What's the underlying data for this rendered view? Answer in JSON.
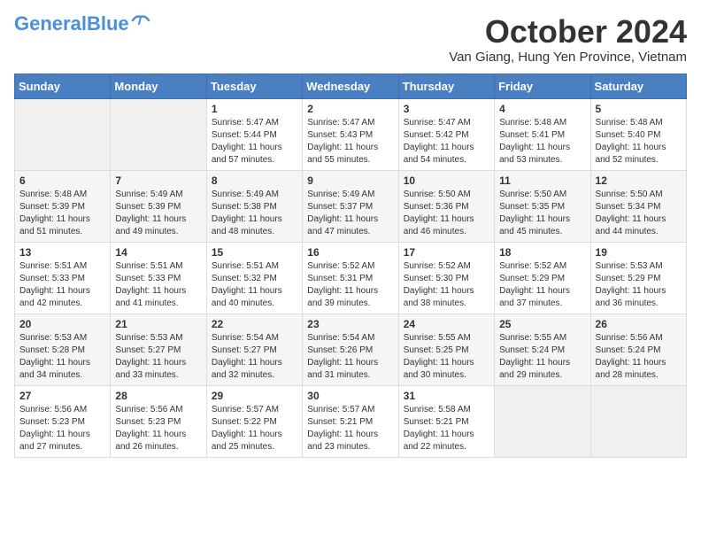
{
  "header": {
    "logo_general": "General",
    "logo_blue": "Blue",
    "month_title": "October 2024",
    "location": "Van Giang, Hung Yen Province, Vietnam"
  },
  "weekdays": [
    "Sunday",
    "Monday",
    "Tuesday",
    "Wednesday",
    "Thursday",
    "Friday",
    "Saturday"
  ],
  "weeks": [
    [
      {
        "day": "",
        "sunrise": "",
        "sunset": "",
        "daylight": ""
      },
      {
        "day": "",
        "sunrise": "",
        "sunset": "",
        "daylight": ""
      },
      {
        "day": "1",
        "sunrise": "Sunrise: 5:47 AM",
        "sunset": "Sunset: 5:44 PM",
        "daylight": "Daylight: 11 hours and 57 minutes."
      },
      {
        "day": "2",
        "sunrise": "Sunrise: 5:47 AM",
        "sunset": "Sunset: 5:43 PM",
        "daylight": "Daylight: 11 hours and 55 minutes."
      },
      {
        "day": "3",
        "sunrise": "Sunrise: 5:47 AM",
        "sunset": "Sunset: 5:42 PM",
        "daylight": "Daylight: 11 hours and 54 minutes."
      },
      {
        "day": "4",
        "sunrise": "Sunrise: 5:48 AM",
        "sunset": "Sunset: 5:41 PM",
        "daylight": "Daylight: 11 hours and 53 minutes."
      },
      {
        "day": "5",
        "sunrise": "Sunrise: 5:48 AM",
        "sunset": "Sunset: 5:40 PM",
        "daylight": "Daylight: 11 hours and 52 minutes."
      }
    ],
    [
      {
        "day": "6",
        "sunrise": "Sunrise: 5:48 AM",
        "sunset": "Sunset: 5:39 PM",
        "daylight": "Daylight: 11 hours and 51 minutes."
      },
      {
        "day": "7",
        "sunrise": "Sunrise: 5:49 AM",
        "sunset": "Sunset: 5:39 PM",
        "daylight": "Daylight: 11 hours and 49 minutes."
      },
      {
        "day": "8",
        "sunrise": "Sunrise: 5:49 AM",
        "sunset": "Sunset: 5:38 PM",
        "daylight": "Daylight: 11 hours and 48 minutes."
      },
      {
        "day": "9",
        "sunrise": "Sunrise: 5:49 AM",
        "sunset": "Sunset: 5:37 PM",
        "daylight": "Daylight: 11 hours and 47 minutes."
      },
      {
        "day": "10",
        "sunrise": "Sunrise: 5:50 AM",
        "sunset": "Sunset: 5:36 PM",
        "daylight": "Daylight: 11 hours and 46 minutes."
      },
      {
        "day": "11",
        "sunrise": "Sunrise: 5:50 AM",
        "sunset": "Sunset: 5:35 PM",
        "daylight": "Daylight: 11 hours and 45 minutes."
      },
      {
        "day": "12",
        "sunrise": "Sunrise: 5:50 AM",
        "sunset": "Sunset: 5:34 PM",
        "daylight": "Daylight: 11 hours and 44 minutes."
      }
    ],
    [
      {
        "day": "13",
        "sunrise": "Sunrise: 5:51 AM",
        "sunset": "Sunset: 5:33 PM",
        "daylight": "Daylight: 11 hours and 42 minutes."
      },
      {
        "day": "14",
        "sunrise": "Sunrise: 5:51 AM",
        "sunset": "Sunset: 5:33 PM",
        "daylight": "Daylight: 11 hours and 41 minutes."
      },
      {
        "day": "15",
        "sunrise": "Sunrise: 5:51 AM",
        "sunset": "Sunset: 5:32 PM",
        "daylight": "Daylight: 11 hours and 40 minutes."
      },
      {
        "day": "16",
        "sunrise": "Sunrise: 5:52 AM",
        "sunset": "Sunset: 5:31 PM",
        "daylight": "Daylight: 11 hours and 39 minutes."
      },
      {
        "day": "17",
        "sunrise": "Sunrise: 5:52 AM",
        "sunset": "Sunset: 5:30 PM",
        "daylight": "Daylight: 11 hours and 38 minutes."
      },
      {
        "day": "18",
        "sunrise": "Sunrise: 5:52 AM",
        "sunset": "Sunset: 5:29 PM",
        "daylight": "Daylight: 11 hours and 37 minutes."
      },
      {
        "day": "19",
        "sunrise": "Sunrise: 5:53 AM",
        "sunset": "Sunset: 5:29 PM",
        "daylight": "Daylight: 11 hours and 36 minutes."
      }
    ],
    [
      {
        "day": "20",
        "sunrise": "Sunrise: 5:53 AM",
        "sunset": "Sunset: 5:28 PM",
        "daylight": "Daylight: 11 hours and 34 minutes."
      },
      {
        "day": "21",
        "sunrise": "Sunrise: 5:53 AM",
        "sunset": "Sunset: 5:27 PM",
        "daylight": "Daylight: 11 hours and 33 minutes."
      },
      {
        "day": "22",
        "sunrise": "Sunrise: 5:54 AM",
        "sunset": "Sunset: 5:27 PM",
        "daylight": "Daylight: 11 hours and 32 minutes."
      },
      {
        "day": "23",
        "sunrise": "Sunrise: 5:54 AM",
        "sunset": "Sunset: 5:26 PM",
        "daylight": "Daylight: 11 hours and 31 minutes."
      },
      {
        "day": "24",
        "sunrise": "Sunrise: 5:55 AM",
        "sunset": "Sunset: 5:25 PM",
        "daylight": "Daylight: 11 hours and 30 minutes."
      },
      {
        "day": "25",
        "sunrise": "Sunrise: 5:55 AM",
        "sunset": "Sunset: 5:24 PM",
        "daylight": "Daylight: 11 hours and 29 minutes."
      },
      {
        "day": "26",
        "sunrise": "Sunrise: 5:56 AM",
        "sunset": "Sunset: 5:24 PM",
        "daylight": "Daylight: 11 hours and 28 minutes."
      }
    ],
    [
      {
        "day": "27",
        "sunrise": "Sunrise: 5:56 AM",
        "sunset": "Sunset: 5:23 PM",
        "daylight": "Daylight: 11 hours and 27 minutes."
      },
      {
        "day": "28",
        "sunrise": "Sunrise: 5:56 AM",
        "sunset": "Sunset: 5:23 PM",
        "daylight": "Daylight: 11 hours and 26 minutes."
      },
      {
        "day": "29",
        "sunrise": "Sunrise: 5:57 AM",
        "sunset": "Sunset: 5:22 PM",
        "daylight": "Daylight: 11 hours and 25 minutes."
      },
      {
        "day": "30",
        "sunrise": "Sunrise: 5:57 AM",
        "sunset": "Sunset: 5:21 PM",
        "daylight": "Daylight: 11 hours and 23 minutes."
      },
      {
        "day": "31",
        "sunrise": "Sunrise: 5:58 AM",
        "sunset": "Sunset: 5:21 PM",
        "daylight": "Daylight: 11 hours and 22 minutes."
      },
      {
        "day": "",
        "sunrise": "",
        "sunset": "",
        "daylight": ""
      },
      {
        "day": "",
        "sunrise": "",
        "sunset": "",
        "daylight": ""
      }
    ]
  ]
}
